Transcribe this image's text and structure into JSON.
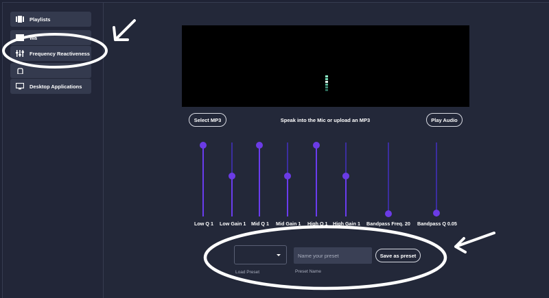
{
  "sidebar": {
    "items": [
      {
        "label": "Playlists",
        "icon": "playlist-icon"
      },
      {
        "label": "Wa",
        "icon": "waveform-icon"
      },
      {
        "label": "Frequency Reactiveness",
        "icon": "sliders-icon"
      },
      {
        "label": "",
        "icon": "hand-icon"
      },
      {
        "label": "Desktop Applications",
        "icon": "monitor-icon"
      }
    ]
  },
  "controls": {
    "select_mp3": "Select MP3",
    "hint": "Speak into the Mic or upload an MP3",
    "play_audio": "Play Audio"
  },
  "sliders": [
    {
      "label": "Low Q 1",
      "level": 1.0
    },
    {
      "label": "Low Gain 1",
      "level": 0.55
    },
    {
      "label": "Mid Q 1",
      "level": 1.0
    },
    {
      "label": "Mid Gain 1",
      "level": 0.55
    },
    {
      "label": "High Q 1",
      "level": 1.0
    },
    {
      "label": "High Gain 1",
      "level": 0.55
    },
    {
      "label": "Bandpass Freq. 20",
      "level": 0.0
    },
    {
      "label": "Bandpass Q 0.05",
      "level": 0.05
    }
  ],
  "preset": {
    "load_label": "Load Preset",
    "name_placeholder": "Name your preset",
    "name_label": "Preset Name",
    "save_label": "Save as preset"
  },
  "colors": {
    "accent": "#6b3be6",
    "annotation": "#ffffff",
    "meter": "#7ee0b8"
  }
}
